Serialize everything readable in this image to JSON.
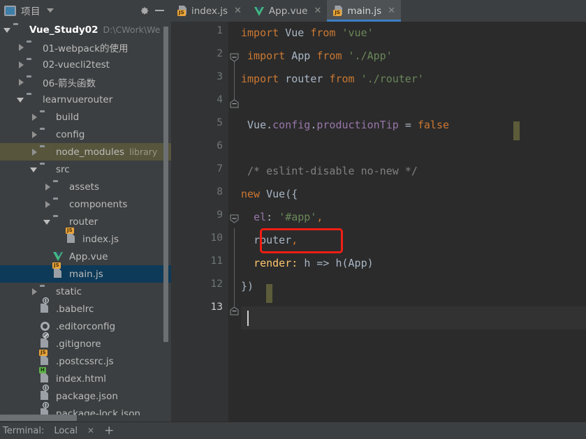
{
  "sidebar": {
    "header": {
      "title": "项目",
      "dropdown_icon": "chevron-down-icon",
      "settings_icon": "gear-icon",
      "minimize_icon": "minimize-icon",
      "project_icon": "project-panel-icon"
    },
    "tree": [
      {
        "label": "Vue_Study02",
        "sub": "D:\\CWork\\We",
        "icon": "folder-icon",
        "arrow": "down",
        "indent": 0,
        "state": "root"
      },
      {
        "label": "01-webpack的使用",
        "sub": "",
        "icon": "folder-icon",
        "arrow": "right",
        "indent": 1,
        "state": "normal"
      },
      {
        "label": "02-vuecli2test",
        "sub": "",
        "icon": "folder-icon",
        "arrow": "right",
        "indent": 1,
        "state": "normal"
      },
      {
        "label": "06-箭头函数",
        "sub": "",
        "icon": "folder-icon",
        "arrow": "right",
        "indent": 1,
        "state": "normal"
      },
      {
        "label": "learnvuerouter",
        "sub": "",
        "icon": "folder-icon",
        "arrow": "down",
        "indent": 1,
        "state": "normal"
      },
      {
        "label": "build",
        "sub": "",
        "icon": "folder-icon",
        "arrow": "right",
        "indent": 2,
        "state": "normal"
      },
      {
        "label": "config",
        "sub": "",
        "icon": "folder-icon",
        "arrow": "right",
        "indent": 2,
        "state": "normal"
      },
      {
        "label": "node_modules",
        "sub": "library",
        "icon": "folder-icon",
        "arrow": "right",
        "indent": 2,
        "state": "library"
      },
      {
        "label": "src",
        "sub": "",
        "icon": "folder-icon",
        "arrow": "down",
        "indent": 2,
        "state": "normal"
      },
      {
        "label": "assets",
        "sub": "",
        "icon": "folder-icon",
        "arrow": "right",
        "indent": 3,
        "state": "normal"
      },
      {
        "label": "components",
        "sub": "",
        "icon": "folder-icon",
        "arrow": "right",
        "indent": 3,
        "state": "normal"
      },
      {
        "label": "router",
        "sub": "",
        "icon": "folder-icon",
        "arrow": "down",
        "indent": 3,
        "state": "normal"
      },
      {
        "label": "index.js",
        "sub": "",
        "icon": "js-file-icon",
        "arrow": "none",
        "indent": 4,
        "state": "normal"
      },
      {
        "label": "App.vue",
        "sub": "",
        "icon": "vue-file-icon",
        "arrow": "none",
        "indent": 3,
        "state": "normal"
      },
      {
        "label": "main.js",
        "sub": "",
        "icon": "js-file-icon",
        "arrow": "none",
        "indent": 3,
        "state": "selected"
      },
      {
        "label": "static",
        "sub": "",
        "icon": "folder-icon",
        "arrow": "right",
        "indent": 2,
        "state": "normal"
      },
      {
        "label": ".babelrc",
        "sub": "",
        "icon": "json-file-icon",
        "arrow": "none",
        "indent": 2,
        "state": "normal"
      },
      {
        "label": ".editorconfig",
        "sub": "",
        "icon": "gear-file-icon",
        "arrow": "none",
        "indent": 2,
        "state": "normal"
      },
      {
        "label": ".gitignore",
        "sub": "",
        "icon": "gitignore-file-icon",
        "arrow": "none",
        "indent": 2,
        "state": "normal"
      },
      {
        "label": ".postcssrc.js",
        "sub": "",
        "icon": "js-file-icon",
        "arrow": "none",
        "indent": 2,
        "state": "normal"
      },
      {
        "label": "index.html",
        "sub": "",
        "icon": "html-file-icon",
        "arrow": "none",
        "indent": 2,
        "state": "normal"
      },
      {
        "label": "package.json",
        "sub": "",
        "icon": "json-file-icon",
        "arrow": "none",
        "indent": 2,
        "state": "normal"
      },
      {
        "label": "package-lock.json",
        "sub": "",
        "icon": "json-file-icon",
        "arrow": "none",
        "indent": 2,
        "state": "normal"
      }
    ],
    "badges": {
      "js": "JS",
      "html": "H"
    }
  },
  "tabs": [
    {
      "label": "index.js",
      "icon": "js-file-icon",
      "active": false,
      "close": "✕"
    },
    {
      "label": "App.vue",
      "icon": "vue-file-icon",
      "active": false,
      "close": "✕"
    },
    {
      "label": "main.js",
      "icon": "js-file-icon",
      "active": true,
      "close": "✕"
    }
  ],
  "editor": {
    "line_numbers": [
      "1",
      "2",
      "3",
      "4",
      "5",
      "6",
      "7",
      "8",
      "9",
      "10",
      "11",
      "12",
      "13"
    ],
    "current_line": 13,
    "annotation": {
      "type": "red-rectangle",
      "color": "#f01e14",
      "target_text": "router,",
      "line": 10
    },
    "lines": [
      {
        "n": 1,
        "text": "import Vue from 'vue'"
      },
      {
        "n": 2,
        "text": "import App from './App'"
      },
      {
        "n": 3,
        "text": "import router from './router'"
      },
      {
        "n": 4,
        "text": ""
      },
      {
        "n": 5,
        "text": "Vue.config.productionTip = false"
      },
      {
        "n": 6,
        "text": ""
      },
      {
        "n": 7,
        "text": "/* eslint-disable no-new */"
      },
      {
        "n": 8,
        "text": "new Vue({"
      },
      {
        "n": 9,
        "text": "  el: '#app',"
      },
      {
        "n": 10,
        "text": "  router,"
      },
      {
        "n": 11,
        "text": "  render: h => h(App)"
      },
      {
        "n": 12,
        "text": "})"
      },
      {
        "n": 13,
        "text": ""
      }
    ],
    "tokens": {
      "l1": {
        "kw1": "import",
        "name": "Vue",
        "kw2": "from",
        "str": "'vue'"
      },
      "l2": {
        "kw1": "import",
        "name": "App",
        "kw2": "from",
        "str": "'./App'"
      },
      "l3": {
        "kw1": "import",
        "name": "router",
        "kw2": "from",
        "str": "'./router'"
      },
      "l5": {
        "obj": "Vue",
        "p1": "config",
        "p2": "productionTip",
        "eq": "=",
        "val": "false"
      },
      "l7": {
        "comment": "/* eslint-disable no-new */"
      },
      "l8": {
        "kw": "new",
        "name": "Vue",
        "open": "({"
      },
      "l9": {
        "prop": "el",
        "str": "'#app'",
        "comma": ","
      },
      "l10": {
        "prop": "router",
        "comma": ","
      },
      "l11": {
        "prop": "render",
        "colon": ":",
        "h1": "h",
        "arrow": "=>",
        "call": "h(App)"
      },
      "l12": {
        "close": "})"
      }
    }
  },
  "bottom_bar": {
    "terminal_label": "Terminal:",
    "session_label": "Local",
    "close_icon": "✕",
    "add_icon": "+"
  },
  "colors": {
    "bg_editor": "#2b2b2b",
    "bg_panel": "#3c3f41",
    "gutter": "#313335",
    "selection": "#0d3a58",
    "library_row": "#57563c",
    "keyword": "#cc7832",
    "identifier": "#a9b7c6",
    "string": "#6a8759",
    "property": "#9876aa",
    "function": "#ffc66d",
    "comment": "#808080",
    "tab_underline": "#3d7ec4",
    "annotation": "#f01e14"
  }
}
